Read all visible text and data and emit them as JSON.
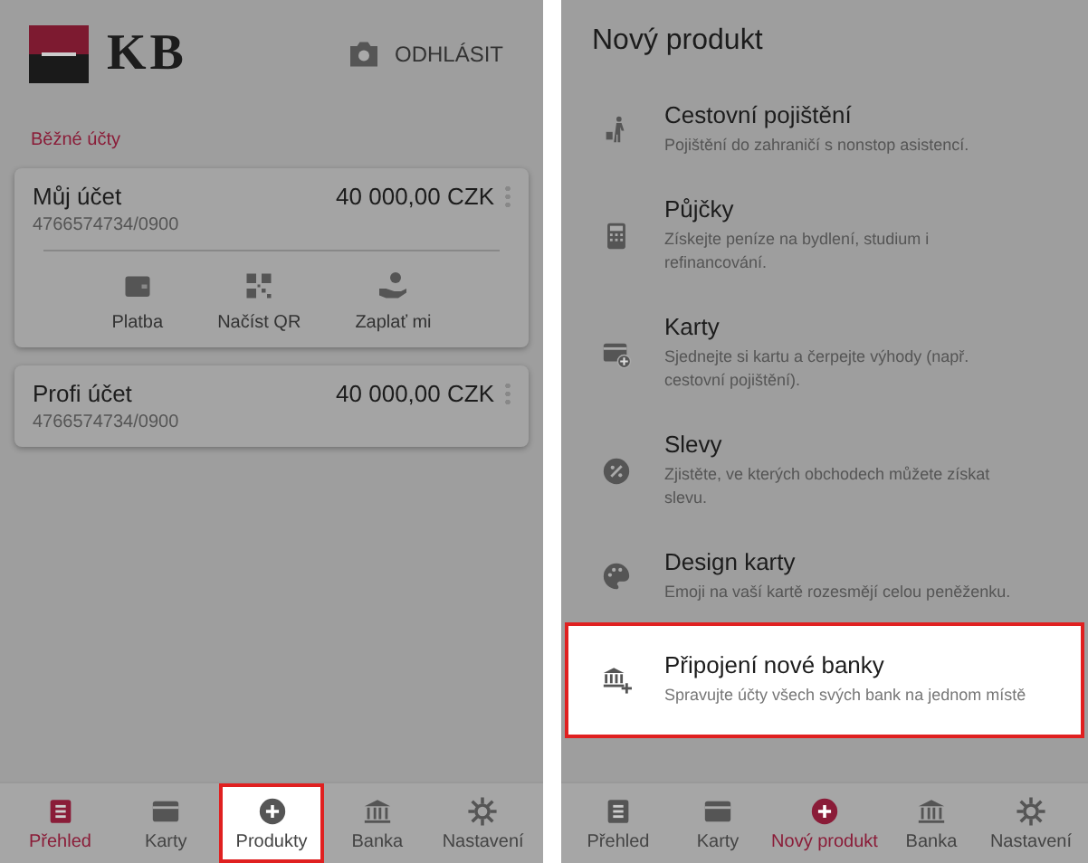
{
  "left_screen": {
    "logo_text": "KB",
    "logout": "ODHLÁSIT",
    "section_title": "Běžné účty",
    "accounts": [
      {
        "name": "Můj účet",
        "number": "4766574734/0900",
        "balance": "40 000,00 CZK",
        "actions": [
          {
            "kind": "wallet",
            "label": "Platba"
          },
          {
            "kind": "qr",
            "label": "Načíst QR"
          },
          {
            "kind": "coin-hand",
            "label": "Zaplať mi"
          }
        ]
      },
      {
        "name": "Profi účet",
        "number": "4766574734/0900",
        "balance": "40 000,00 CZK"
      }
    ],
    "nav": [
      {
        "kind": "overview",
        "label": "Přehled",
        "selected": true,
        "highlighted": false
      },
      {
        "kind": "card",
        "label": "Karty",
        "selected": false,
        "highlighted": false
      },
      {
        "kind": "plus",
        "label": "Produkty",
        "selected": false,
        "highlighted": true
      },
      {
        "kind": "bank",
        "label": "Banka",
        "selected": false,
        "highlighted": false
      },
      {
        "kind": "gear",
        "label": "Nastavení",
        "selected": false,
        "highlighted": false
      }
    ]
  },
  "right_screen": {
    "title": "Nový produkt",
    "items": [
      {
        "kind": "traveler",
        "title": "Cestovní pojištění",
        "description": "Pojištění do zahraničí s nonstop asistencí.",
        "highlighted": false
      },
      {
        "kind": "calculator",
        "title": "Půjčky",
        "description": "Získejte peníze na bydlení, studium i refinancování.",
        "highlighted": false
      },
      {
        "kind": "card-add",
        "title": "Karty",
        "description": "Sjednejte si kartu a čerpejte výhody (např. cestovní pojištění).",
        "highlighted": false
      },
      {
        "kind": "discount",
        "title": "Slevy",
        "description": "Zjistěte, ve kterých obchodech můžete získat slevu.",
        "highlighted": false
      },
      {
        "kind": "palette",
        "title": "Design karty",
        "description": "Emoji na vaší kartě rozesmějí celou peněženku.",
        "highlighted": false
      },
      {
        "kind": "bank-add",
        "title": "Připojení nové banky",
        "description": "Spravujte účty všech svých bank na jednom místě",
        "highlighted": true
      }
    ],
    "nav": [
      {
        "kind": "overview",
        "label": "Přehled",
        "selected": false,
        "highlighted": false
      },
      {
        "kind": "card",
        "label": "Karty",
        "selected": false,
        "highlighted": false
      },
      {
        "kind": "plus",
        "label": "Nový produkt",
        "selected": true,
        "highlighted": false
      },
      {
        "kind": "bank",
        "label": "Banka",
        "selected": false,
        "highlighted": false
      },
      {
        "kind": "gear",
        "label": "Nastavení",
        "selected": false,
        "highlighted": false
      }
    ]
  }
}
